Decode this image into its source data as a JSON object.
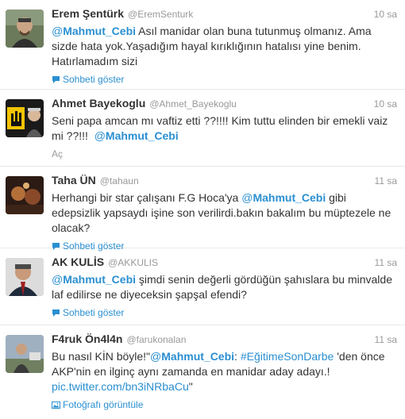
{
  "tweets": [
    {
      "fullname": "Erem Şentürk",
      "username": "@EremSenturk",
      "time": "10 sa",
      "mention_at": "@",
      "mention_name": "Mahmut_Cebi",
      "text_rest": " Asıl manidar olan buna tutunmuş olmanız. Ama sizde hata yok.Yaşadığım hayal kırıklığının hatalısı yine benim. Hatırlamadım sizi",
      "action": "Sohbeti göster",
      "action_icon": "conversation-icon"
    },
    {
      "fullname": "Ahmet Bayekoglu",
      "username": "@Ahmet_Bayekoglu",
      "time": "10 sa",
      "text_before": "Seni papa amcan mı vaftiz etti ??!!!! Kim tuttu elinden bir emekli vaiz mi ??!!!  ",
      "mention_at": "@",
      "mention_name": "Mahmut_Cebi",
      "action": "Aç"
    },
    {
      "fullname": "Taha ÜN",
      "username": "@tahaun",
      "time": "11 sa",
      "text_before": "Herhangi bir star çalışanı F.G Hoca'ya ",
      "mention_at": "@",
      "mention_name": "Mahmut_Cebi",
      "text_rest": " gibi edepsizlik yapsaydı işine son verilirdi.bakın bakalım bu müptezele ne olacak?",
      "action": "Sohbeti göster",
      "action_icon": "conversation-icon"
    },
    {
      "fullname": "AK KULİS",
      "username": "@AKKULIS",
      "time": "11 sa",
      "mention_at": "@",
      "mention_name": "Mahmut_Cebi",
      "text_rest": " şimdi senin değerli gördüğün şahıslara bu minvalde laf edilirse ne diyeceksin şapşal efendi?",
      "action": "Sohbeti göster",
      "action_icon": "conversation-icon"
    },
    {
      "fullname": "F4ruk Ön4l4n",
      "username": "@farukonalan",
      "time": "11 sa",
      "text_before": "Bu nasıl KİN böyle!\"",
      "mention_at": "@",
      "mention_name": "Mahmut_Cebi",
      "text_mid": ": ",
      "hashtag": "#EğitimeSonDarbe",
      "text_rest": " 'den önce AKP'nin en ilginç aynı zamanda en manidar aday adayı.! ",
      "link": "pic.twitter.com/bn3iNRbaCu",
      "text_end": "\"",
      "action": "Fotoğrafı görüntüle",
      "action_icon": "photo-icon"
    }
  ],
  "colors": {
    "link": "#2a8fd1",
    "text": "#333333",
    "meta": "#999999",
    "divider": "#e8e8e8"
  }
}
